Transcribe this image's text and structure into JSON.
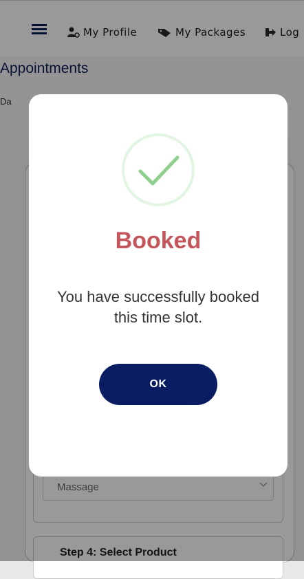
{
  "nav": {
    "items": [
      {
        "label": "My Profile",
        "icon": "user-cog-icon"
      },
      {
        "label": "My Packages",
        "icon": "tag-icon"
      },
      {
        "label": "Log",
        "icon": "logout-icon"
      }
    ]
  },
  "page": {
    "title": "Appointments",
    "date_label": "Da"
  },
  "form": {
    "service_select_value": "Massage",
    "step4_title": "Step 4: Select Product"
  },
  "modal": {
    "title": "Booked",
    "message": "You have successfully booked this time slot.",
    "ok_label": "OK"
  },
  "colors": {
    "brand_navy": "#0a1d63",
    "title_red": "#c4565b",
    "success_green": "#8fd08f"
  }
}
